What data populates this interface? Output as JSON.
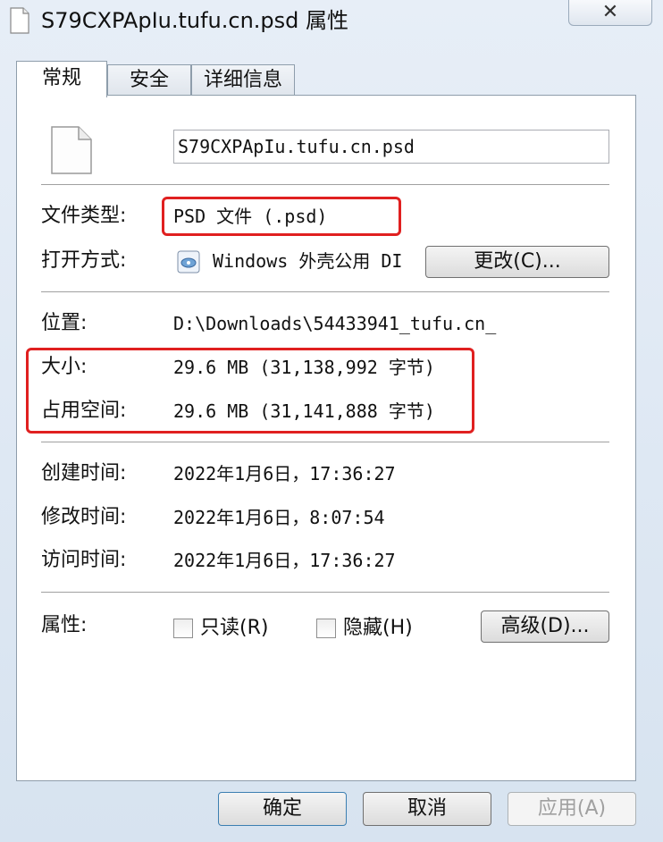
{
  "window": {
    "title": "S79CXPApIu.tufu.cn.psd 属性",
    "close_icon": "close-icon"
  },
  "tabs": [
    {
      "label": "常规",
      "active": true
    },
    {
      "label": "安全",
      "active": false
    },
    {
      "label": "详细信息",
      "active": false
    }
  ],
  "general": {
    "file_name": "S79CXPApIu.tufu.cn.psd",
    "file_type_label": "文件类型:",
    "file_type_value": "PSD 文件 (.psd)",
    "opens_with_label": "打开方式:",
    "opens_with_value": "Windows 外壳公用 DI",
    "change_button": "更改(C)...",
    "location_label": "位置:",
    "location_value": "D:\\Downloads\\54433941_tufu.cn_",
    "size_label": "大小:",
    "size_value": "29.6 MB (31,138,992 字节)",
    "size_on_disk_label": "占用空间:",
    "size_on_disk_value": "29.6 MB (31,141,888 字节)",
    "created_label": "创建时间:",
    "created_value": "2022年1月6日，17:36:27",
    "modified_label": "修改时间:",
    "modified_value": "2022年1月6日，8:07:54",
    "accessed_label": "访问时间:",
    "accessed_value": "2022年1月6日，17:36:27",
    "attributes_label": "属性:",
    "readonly_label": "只读(R)",
    "readonly_checked": false,
    "hidden_label": "隐藏(H)",
    "hidden_checked": false,
    "advanced_button": "高级(D)..."
  },
  "footer": {
    "ok": "确定",
    "cancel": "取消",
    "apply": "应用(A)"
  },
  "colors": {
    "highlight_box": "#e02020",
    "panel": "#ffffff",
    "window": "#dbe6f2"
  }
}
